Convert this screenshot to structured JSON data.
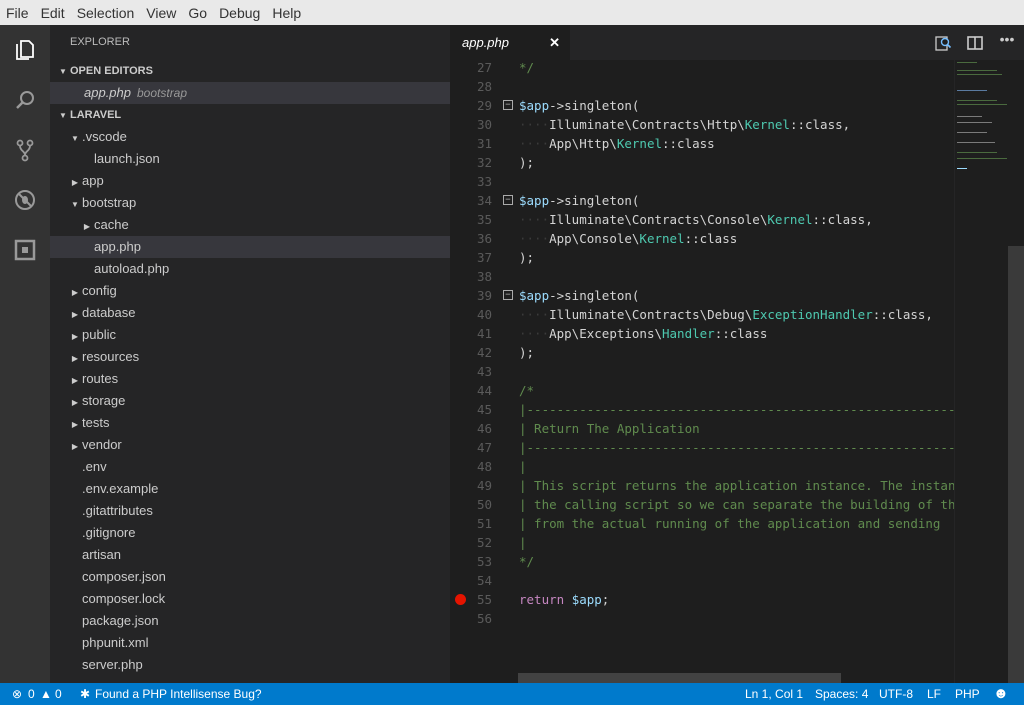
{
  "menu": [
    "File",
    "Edit",
    "Selection",
    "View",
    "Go",
    "Debug",
    "Help"
  ],
  "activity": [
    "files-icon",
    "search-icon",
    "source-control-icon",
    "debug-icon",
    "extensions-icon"
  ],
  "sidebar": {
    "title": "EXPLORER",
    "open_editors": "OPEN EDITORS",
    "open_file": {
      "name": "app.php",
      "desc": "bootstrap"
    },
    "project": "LARAVEL",
    "tree": [
      {
        "name": ".vscode",
        "depth": 1,
        "twisty": "open"
      },
      {
        "name": "launch.json",
        "depth": 2,
        "twisty": ""
      },
      {
        "name": "app",
        "depth": 1,
        "twisty": "closed"
      },
      {
        "name": "bootstrap",
        "depth": 1,
        "twisty": "open"
      },
      {
        "name": "cache",
        "depth": 2,
        "twisty": "closed"
      },
      {
        "name": "app.php",
        "depth": 2,
        "twisty": "",
        "selected": true
      },
      {
        "name": "autoload.php",
        "depth": 2,
        "twisty": ""
      },
      {
        "name": "config",
        "depth": 1,
        "twisty": "closed"
      },
      {
        "name": "database",
        "depth": 1,
        "twisty": "closed"
      },
      {
        "name": "public",
        "depth": 1,
        "twisty": "closed"
      },
      {
        "name": "resources",
        "depth": 1,
        "twisty": "closed"
      },
      {
        "name": "routes",
        "depth": 1,
        "twisty": "closed"
      },
      {
        "name": "storage",
        "depth": 1,
        "twisty": "closed"
      },
      {
        "name": "tests",
        "depth": 1,
        "twisty": "closed"
      },
      {
        "name": "vendor",
        "depth": 1,
        "twisty": "closed"
      },
      {
        "name": ".env",
        "depth": 1,
        "twisty": ""
      },
      {
        "name": ".env.example",
        "depth": 1,
        "twisty": ""
      },
      {
        "name": ".gitattributes",
        "depth": 1,
        "twisty": ""
      },
      {
        "name": ".gitignore",
        "depth": 1,
        "twisty": ""
      },
      {
        "name": "artisan",
        "depth": 1,
        "twisty": ""
      },
      {
        "name": "composer.json",
        "depth": 1,
        "twisty": ""
      },
      {
        "name": "composer.lock",
        "depth": 1,
        "twisty": ""
      },
      {
        "name": "package.json",
        "depth": 1,
        "twisty": ""
      },
      {
        "name": "phpunit.xml",
        "depth": 1,
        "twisty": ""
      },
      {
        "name": "server.php",
        "depth": 1,
        "twisty": ""
      }
    ]
  },
  "tab": {
    "label": "app.php",
    "close": "✕"
  },
  "editor_actions": [
    "open-preview-icon",
    "split-editor-icon",
    "more-icon"
  ],
  "code": [
    {
      "n": 27,
      "s": [
        [
          "c",
          "*/"
        ]
      ]
    },
    {
      "n": 28,
      "s": []
    },
    {
      "n": 29,
      "fold": true,
      "s": [
        [
          "v",
          "$app"
        ],
        [
          "p",
          "->singleton("
        ]
      ]
    },
    {
      "n": 30,
      "s": [
        [
          "w",
          "····"
        ],
        [
          "p",
          "Illuminate\\Contracts\\Http\\"
        ],
        [
          "t",
          "Kernel"
        ],
        [
          "p",
          "::class,"
        ]
      ]
    },
    {
      "n": 31,
      "s": [
        [
          "w",
          "····"
        ],
        [
          "p",
          "App\\Http\\"
        ],
        [
          "t",
          "Kernel"
        ],
        [
          "p",
          "::class"
        ]
      ]
    },
    {
      "n": 32,
      "s": [
        [
          "p",
          ");"
        ]
      ]
    },
    {
      "n": 33,
      "s": []
    },
    {
      "n": 34,
      "fold": true,
      "s": [
        [
          "v",
          "$app"
        ],
        [
          "p",
          "->singleton("
        ]
      ]
    },
    {
      "n": 35,
      "s": [
        [
          "w",
          "····"
        ],
        [
          "p",
          "Illuminate\\Contracts\\Console\\"
        ],
        [
          "t",
          "Kernel"
        ],
        [
          "p",
          "::class,"
        ]
      ]
    },
    {
      "n": 36,
      "s": [
        [
          "w",
          "····"
        ],
        [
          "p",
          "App\\Console\\"
        ],
        [
          "t",
          "Kernel"
        ],
        [
          "p",
          "::class"
        ]
      ]
    },
    {
      "n": 37,
      "s": [
        [
          "p",
          ");"
        ]
      ]
    },
    {
      "n": 38,
      "s": []
    },
    {
      "n": 39,
      "fold": true,
      "s": [
        [
          "v",
          "$app"
        ],
        [
          "p",
          "->singleton("
        ]
      ]
    },
    {
      "n": 40,
      "s": [
        [
          "w",
          "····"
        ],
        [
          "p",
          "Illuminate\\Contracts\\Debug\\"
        ],
        [
          "t",
          "ExceptionHandler"
        ],
        [
          "p",
          "::class,"
        ]
      ]
    },
    {
      "n": 41,
      "s": [
        [
          "w",
          "····"
        ],
        [
          "p",
          "App\\Exceptions\\"
        ],
        [
          "t",
          "Handler"
        ],
        [
          "p",
          "::class"
        ]
      ]
    },
    {
      "n": 42,
      "s": [
        [
          "p",
          ");"
        ]
      ]
    },
    {
      "n": 43,
      "s": []
    },
    {
      "n": 44,
      "s": [
        [
          "c",
          "/*"
        ]
      ]
    },
    {
      "n": 45,
      "s": [
        [
          "c",
          "|--------------------------------------------------------------"
        ]
      ]
    },
    {
      "n": 46,
      "s": [
        [
          "c",
          "| Return The Application"
        ]
      ]
    },
    {
      "n": 47,
      "s": [
        [
          "c",
          "|--------------------------------------------------------------"
        ]
      ]
    },
    {
      "n": 48,
      "s": [
        [
          "c",
          "|"
        ]
      ]
    },
    {
      "n": 49,
      "s": [
        [
          "c",
          "| This script returns the application instance. The instance"
        ]
      ]
    },
    {
      "n": 50,
      "s": [
        [
          "c",
          "| the calling script so we can separate the building of the"
        ]
      ]
    },
    {
      "n": 51,
      "s": [
        [
          "c",
          "| from the actual running of the application and sending"
        ]
      ]
    },
    {
      "n": 52,
      "s": [
        [
          "c",
          "|"
        ]
      ]
    },
    {
      "n": 53,
      "s": [
        [
          "c",
          "*/"
        ]
      ]
    },
    {
      "n": 54,
      "s": []
    },
    {
      "n": 55,
      "breakpoint": true,
      "s": [
        [
          "k",
          "return "
        ],
        [
          "v",
          "$app"
        ],
        [
          "p",
          ";"
        ]
      ]
    },
    {
      "n": 56,
      "s": []
    }
  ],
  "status": {
    "errors": "0",
    "warnings": "0",
    "message": "Found a PHP Intellisense Bug?",
    "position": "Ln 1, Col 1",
    "indent": "Spaces: 4",
    "encoding": "UTF-8",
    "eol": "LF",
    "language": "PHP"
  },
  "colors": {
    "statusbar": "#007acc",
    "comment": "#608b4e",
    "variable": "#9cdcfe",
    "type": "#4ec9b0",
    "keyword": "#c586c0",
    "breakpoint": "#e51400"
  }
}
